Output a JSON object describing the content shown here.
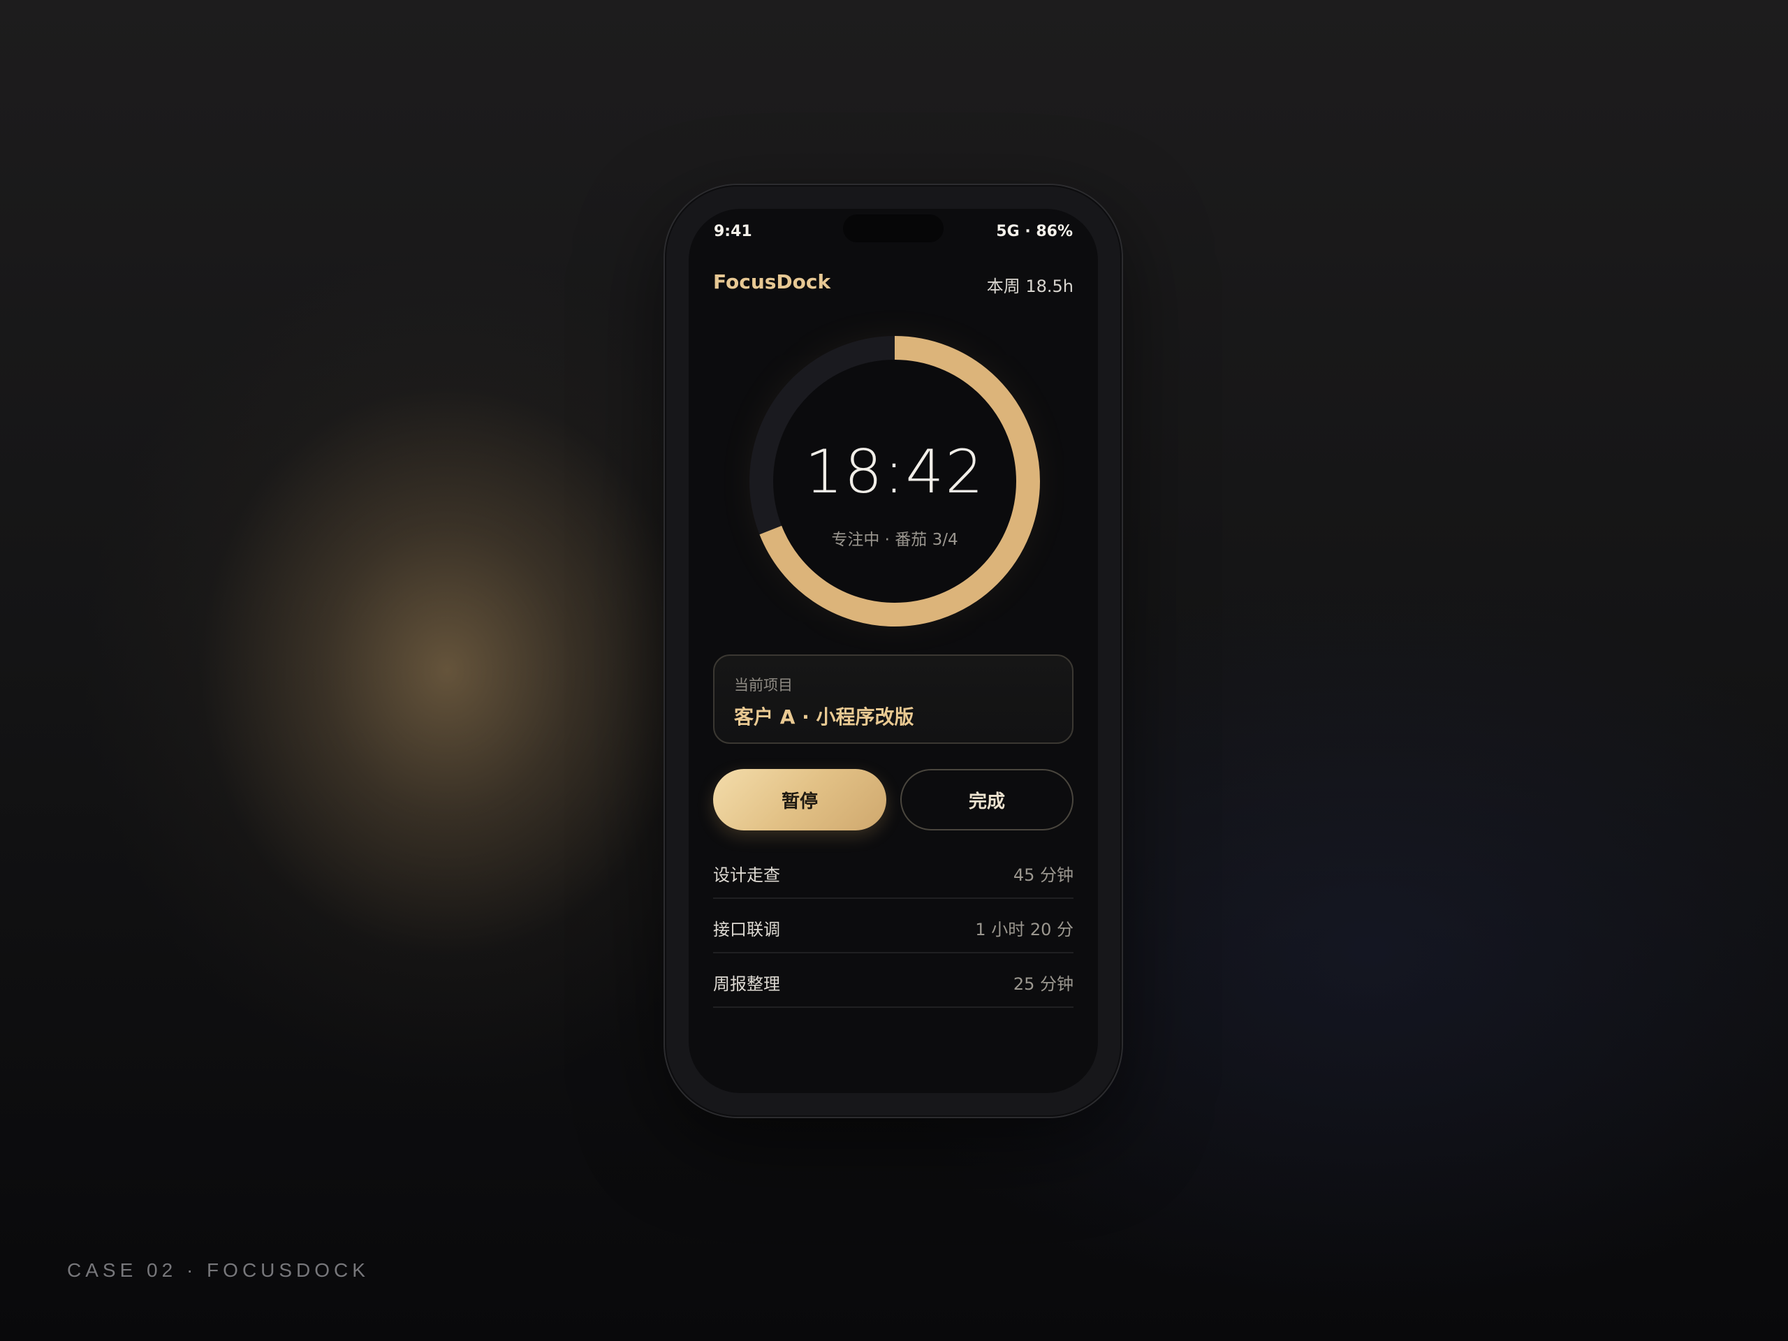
{
  "caption": "CASE 02 · FOCUSDOCK",
  "status_bar": {
    "time": "9:41",
    "network_battery": "5G · 86%"
  },
  "header": {
    "brand": "FocusDock",
    "week_stat": "本周 18.5h"
  },
  "timer": {
    "time": "18:42",
    "status": "专注中 · 番茄 3/4",
    "progress_fraction": 0.69
  },
  "project": {
    "label": "当前项目",
    "name": "客户 A · 小程序改版"
  },
  "actions": {
    "pause_label": "暂停",
    "done_label": "完成"
  },
  "tasks": [
    {
      "name": "设计走查",
      "duration": "45 分钟"
    },
    {
      "name": "接口联调",
      "duration": "1 小时 20 分"
    },
    {
      "name": "周报整理",
      "duration": "25 分钟"
    }
  ],
  "colors": {
    "accent": "#dcb47a",
    "ring_track": "#1a1a1f",
    "background": "#0c0c0e"
  }
}
